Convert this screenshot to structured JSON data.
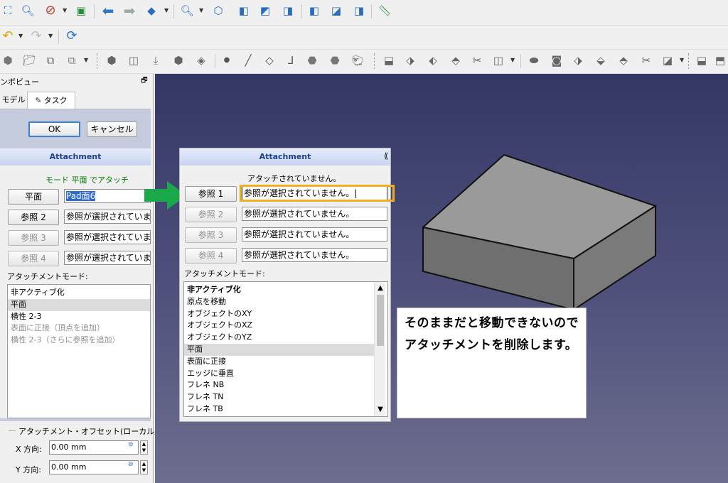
{
  "toolbar": {
    "row1_icons": [
      "view-fit-icon",
      "zoom-icon",
      "no-draw-style-icon",
      "std-views-icon",
      "back-arrow-icon",
      "forward-arrow-icon",
      "workbench-icon",
      "zoom-box-icon",
      "isometric-view-icon",
      "front-view-icon",
      "top-view-icon",
      "right-view-icon",
      "rear-view-icon",
      "bottom-view-icon",
      "left-view-icon",
      "measure-icon"
    ],
    "row2_icons": [
      "undo-icon",
      "redo-icon",
      "refresh-icon"
    ],
    "row3_icons": [
      "body-icon",
      "sketch-icon",
      "attach-sketch-icon",
      "validate-sketch-icon",
      "pad-icon",
      "pocket-icon",
      "point-icon",
      "line-icon",
      "plane-icon",
      "lcs-icon",
      "shape-binder-icon",
      "subshape-binder-icon",
      "clone-icon",
      "additive-primitive-icon",
      "loft-icon",
      "pipe-icon",
      "helix-icon",
      "subtractive-icon",
      "revolution-icon",
      "groove-icon",
      "hole-icon",
      "fillet-icon",
      "chamfer-icon",
      "draft-icon",
      "thickness-icon",
      "mirrored-icon",
      "boolean-icon"
    ]
  },
  "combo": {
    "title": "ンボビュー",
    "float_glyph": "🗗",
    "tab_model": "モデル",
    "tab_task": "タスク",
    "ok": "OK",
    "cancel": "キャンセル"
  },
  "attachment_left": {
    "header": "Attachment",
    "status": "モード 平面 でアタッチ",
    "ref_buttons": [
      "平面",
      "参照 2",
      "参照 3",
      "参照 4"
    ],
    "ref_fields": [
      "Pad面6",
      "参照が選択されていません。",
      "参照が選択されていません。",
      "参照が選択されていません。"
    ],
    "mode_label": "アタッチメントモード:",
    "modes": [
      "非アクティブ化",
      "平面",
      "横性 2-3",
      "表面に正接（頂点を追加）",
      "横性 2-3（さらに参照を追加）"
    ]
  },
  "offset": {
    "title": "アタッチメント・オフセット(ローカル座標系",
    "x_label": "X 方向:",
    "x_value": "0.00 mm",
    "y_label": "Y 方向:",
    "y_value": "0.00 mm"
  },
  "attachment_zoom": {
    "header": "Attachment",
    "status": "アタッチされていません。",
    "ref_buttons": [
      "参照 1",
      "参照 2",
      "参照 3",
      "参照 4"
    ],
    "ref_fields": [
      "参照が選択されていません。",
      "参照が選択されていません。",
      "参照が選択されていません。",
      "参照が選択されていません。"
    ],
    "mode_label": "アタッチメントモード:",
    "modes": [
      "非アクティブ化",
      "原点を移動",
      "オブジェクトのXY",
      "オブジェクトのXZ",
      "オブジェクトのYZ",
      "平面",
      "表面に正接",
      "エッジに垂直",
      "フレネ NB",
      "フレネ TN",
      "フレネ TB"
    ]
  },
  "callout": {
    "text": "そのままだと移動できないのでアタッチメントを削除します。"
  },
  "colors": {
    "highlight": "#f2b01e",
    "arrow": "#1aa84a",
    "header_text": "#1c3f8c",
    "status_green": "#007800"
  }
}
